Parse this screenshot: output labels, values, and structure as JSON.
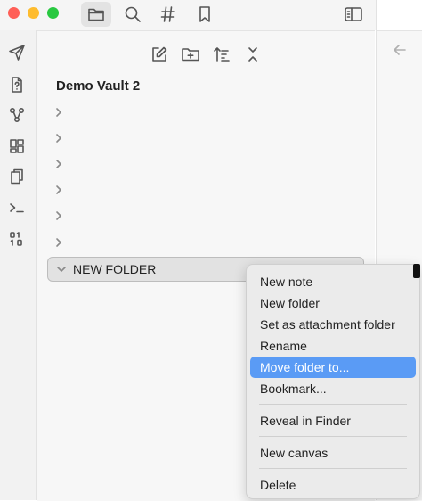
{
  "titlebar": {
    "buttons": [
      {
        "icon": "folder-icon",
        "active": true
      },
      {
        "icon": "search-icon",
        "active": false
      },
      {
        "icon": "tag-icon",
        "active": false
      },
      {
        "icon": "bookmark-icon",
        "active": false
      }
    ],
    "sidebar_toggle_icon": "sidebar-toggle-icon"
  },
  "ribbon": {
    "icons": [
      "send-icon",
      "file-question-icon",
      "graph-icon",
      "dashboard-icon",
      "copy-icon",
      "terminal-icon",
      "binary-icon"
    ]
  },
  "explorer": {
    "toolbar_icons": [
      "new-note-icon",
      "new-folder-icon",
      "sort-icon",
      "collapse-icon"
    ],
    "vault_name": "Demo Vault 2",
    "collapsed_rows": 6,
    "folder_name": "NEW FOLDER"
  },
  "right_panel": {
    "icon": "arrow-left-icon"
  },
  "context_menu": {
    "items": [
      {
        "label": "New note"
      },
      {
        "label": "New folder"
      },
      {
        "label": "Set as attachment folder"
      },
      {
        "label": "Rename"
      },
      {
        "label": "Move folder to...",
        "highlighted": true
      },
      {
        "label": "Bookmark..."
      },
      {
        "label": "Reveal in Finder"
      },
      {
        "label": "New canvas"
      },
      {
        "label": "Delete"
      }
    ]
  },
  "colors": {
    "highlight": "#5a9bf5",
    "traffic_red": "#ff5f57",
    "traffic_yellow": "#febc2e",
    "traffic_green": "#28c840"
  }
}
